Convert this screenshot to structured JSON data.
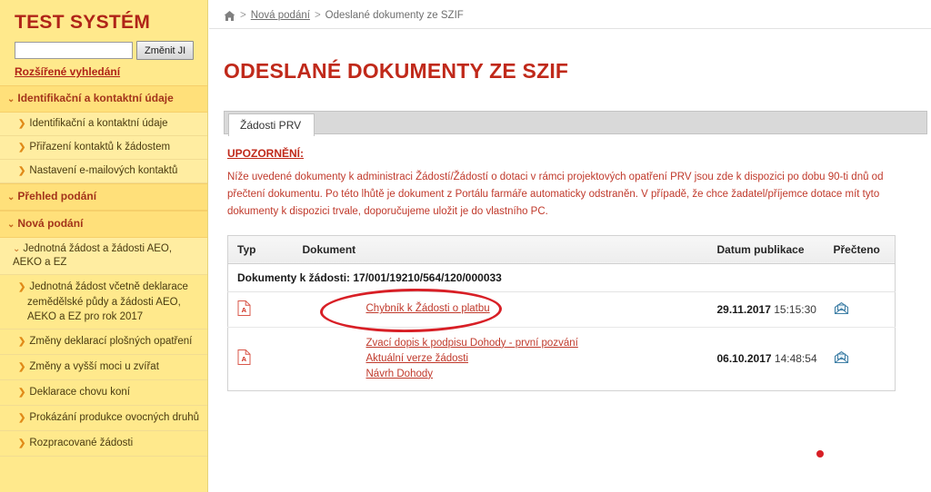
{
  "sidebar": {
    "brand": "TEST SYSTÉM",
    "search": {
      "value": "",
      "placeholder": ""
    },
    "change_ji_button": "Změnit JI",
    "advanced_search_link": "Rozšířené vyhledání",
    "nav": [
      {
        "type": "section",
        "label": "Identifikační a kontaktní údaje",
        "icon": "chevron-down-icon"
      },
      {
        "type": "item",
        "label": "Identifikační a kontaktní údaje",
        "icon": "arrow-right-icon"
      },
      {
        "type": "item",
        "label": "Přiřazení kontaktů k žádostem",
        "icon": "arrow-right-icon"
      },
      {
        "type": "item",
        "label": "Nastavení e-mailových kontaktů",
        "icon": "arrow-right-icon"
      },
      {
        "type": "section",
        "label": "Přehled podání",
        "icon": "chevron-down-icon"
      },
      {
        "type": "section",
        "label": "Nová podání",
        "icon": "chevron-down-icon"
      },
      {
        "type": "subsection",
        "label": "Jednotná žádost a žádosti AEO, AEKO a EZ",
        "icon": "chevron-down-icon"
      },
      {
        "type": "item2",
        "label": "Jednotná žádost včetně deklarace zemědělské půdy a žádosti AEO, AEKO a EZ pro rok 2017",
        "icon": "arrow-right-icon"
      },
      {
        "type": "item2",
        "label": "Změny deklarací plošných opatření",
        "icon": "arrow-right-icon"
      },
      {
        "type": "item2",
        "label": "Změny a vyšší moci u zvířat",
        "icon": "arrow-right-icon"
      },
      {
        "type": "item2",
        "label": "Deklarace chovu koní",
        "icon": "arrow-right-icon"
      },
      {
        "type": "item2",
        "label": "Prokázání produkce ovocných druhů",
        "icon": "arrow-right-icon"
      },
      {
        "type": "item2",
        "label": "Rozpracované žádosti",
        "icon": "arrow-right-icon"
      }
    ]
  },
  "breadcrumb": {
    "home_icon": "home-icon",
    "sep": ">",
    "link": "Nová podání",
    "current": "Odeslané dokumenty ze SZIF"
  },
  "page": {
    "title": "ODESLANÉ DOKUMENTY ZE SZIF"
  },
  "tabs": [
    {
      "label": "Žádosti PRV",
      "active": true
    }
  ],
  "notice": {
    "title": "UPOZORNĚNÍ:",
    "text": "Níže uvedené dokumenty k administraci Žádostí/Žádostí o dotaci v rámci projektových opatření PRV jsou zde k dispozici po dobu 90-ti dnů od přečtení dokumentu. Po této lhůtě je dokument z Portálu farmáře automaticky odstraněn. V případě, že chce žadatel/příjemce dotace mít tyto dokumenty k dispozici trvale, doporučujeme uložit je do vlastního PC."
  },
  "table": {
    "columns": {
      "typ": "Typ",
      "dokument": "Dokument",
      "datum": "Datum publikace",
      "precteno": "Přečteno"
    },
    "group_label": "Dokumenty k žádosti: 17/001/19210/564/120/000033",
    "rows": [
      {
        "type_icon": "pdf-icon",
        "links": [
          "Chybník k Žádosti o platbu"
        ],
        "date": "29.11.2017",
        "time": "15:15:30",
        "read_icon": "envelope-open-icon"
      },
      {
        "type_icon": "pdf-icon",
        "links": [
          "Zvací dopis k podpisu Dohody - první pozvání",
          "Aktuální verze žádosti",
          "Návrh Dohody"
        ],
        "date": "06.10.2017",
        "time": "14:48:54",
        "read_icon": "envelope-open-icon"
      }
    ]
  },
  "annotations": {
    "ellipse": "red-ellipse-highlight",
    "dot": "red-dot-marker"
  },
  "colors": {
    "brand_red": "#b02418",
    "title_red": "#c0291a",
    "link_red": "#c0392b",
    "sidebar_yellow": "#ffe98c",
    "annotation_red": "#d81f26"
  }
}
